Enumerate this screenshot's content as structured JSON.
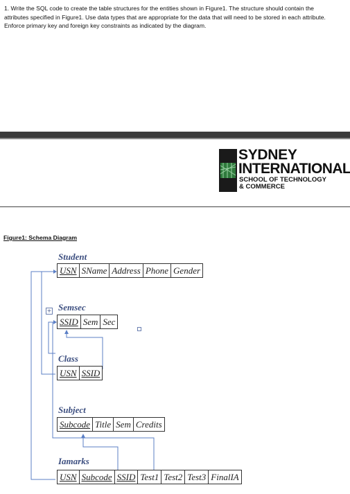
{
  "question": {
    "text": "1. Write the SQL code to create the table structures for the entities shown in Figure1. The structure should contain the attributes specified in Figure1. Use data types that are appropriate for the data that will need to be stored in each attribute. Enforce primary key and foreign key constraints as indicated by the diagram."
  },
  "logo": {
    "line1": "SYDNEY",
    "line2": "INTERNATIONAL",
    "line3": "SCHOOL OF TECHNOLOGY",
    "line4": "& COMMERCE"
  },
  "figure": {
    "caption": "Figure1: Schema Diagram",
    "entities": [
      {
        "name": "Student",
        "attributes": [
          "USN",
          "SName",
          "Address",
          "Phone",
          "Gender"
        ],
        "keys": [
          "USN"
        ]
      },
      {
        "name": "Semsec",
        "attributes": [
          "SSID",
          "Sem",
          "Sec"
        ],
        "keys": [
          "SSID"
        ]
      },
      {
        "name": "Class",
        "attributes": [
          "USN",
          "SSID"
        ],
        "keys": [
          "USN",
          "SSID"
        ]
      },
      {
        "name": "Subject",
        "attributes": [
          "Subcode",
          "Title",
          "Sem",
          "Credits"
        ],
        "keys": [
          "Subcode"
        ]
      },
      {
        "name": "Iamarks",
        "attributes": [
          "USN",
          "Subcode",
          "SSID",
          "Test1",
          "Test2",
          "Test3",
          "FinalIA"
        ],
        "keys": [
          "USN",
          "Subcode",
          "SSID"
        ]
      }
    ],
    "line_color": "#5b7fc6"
  },
  "colors": {
    "banner": "#3b3b3b",
    "entity_title": "#3d4f80"
  }
}
